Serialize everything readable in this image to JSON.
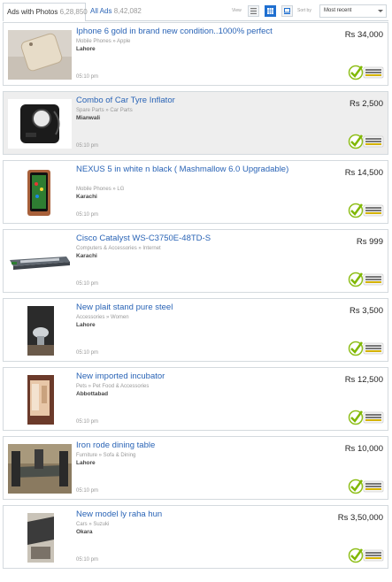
{
  "tabs": {
    "photos_label": "Ads with Photos",
    "photos_count": "6,28,850",
    "all_label": "All Ads",
    "all_count": "8,42,082"
  },
  "toolbar": {
    "view_label": "View",
    "sort_label": "Sort by",
    "sort_value": "Most recent"
  },
  "ads": [
    {
      "title": "Iphone 6 gold in brand new condition..1000% perfect",
      "category": "Mobile Phones » Apple",
      "city": "Lahore",
      "time": "05:10 pm",
      "price": "Rs 34,000",
      "badge": "Phone Number Verified",
      "featured": false
    },
    {
      "title": "Combo of Car Tyre Inflator",
      "category": "Spare Parts » Car Parts",
      "city": "Mianwali",
      "time": "05:10 pm",
      "price": "Rs 2,500",
      "badge": "Phone Number Verified",
      "featured": true
    },
    {
      "title": "NEXUS 5 in white n black ( Mashmallow 6.0 Upgradable)",
      "category": "Mobile Phones » LG",
      "city": "Karachi",
      "time": "05:10 pm",
      "price": "Rs 14,500",
      "badge": "Phone Number Verified",
      "featured": false
    },
    {
      "title": "Cisco Catalyst WS-C3750E-48TD-S",
      "category": "Computers & Accessories » Internet",
      "city": "Karachi",
      "time": "05:10 pm",
      "price": "Rs 999",
      "badge": "Phone Number Verified",
      "featured": false
    },
    {
      "title": "New plait stand pure steel",
      "category": "Accessories » Women",
      "city": "Lahore",
      "time": "05:10 pm",
      "price": "Rs 3,500",
      "badge": "Phone Number Verified",
      "featured": false
    },
    {
      "title": "New imported incubator",
      "category": "Pets » Pet Food & Accessories",
      "city": "Abbottabad",
      "time": "05:10 pm",
      "price": "Rs 12,500",
      "badge": "Phone Number Verified",
      "featured": false
    },
    {
      "title": "Iron rode dining table",
      "category": "Furniture » Sofa & Dining",
      "city": "Lahore",
      "time": "05:10 pm",
      "price": "Rs 10,000",
      "badge": "Phone Number Verified",
      "featured": false
    },
    {
      "title": "New model ly raha hun",
      "category": "Cars » Suzuki",
      "city": "Okara",
      "time": "05:10 pm",
      "price": "Rs 3,50,000",
      "badge": "Phone Number Verified",
      "featured": false
    }
  ],
  "colors": {
    "link": "#2a64b6",
    "featured_bg": "#eeeeee",
    "verified": "#7fb800"
  }
}
